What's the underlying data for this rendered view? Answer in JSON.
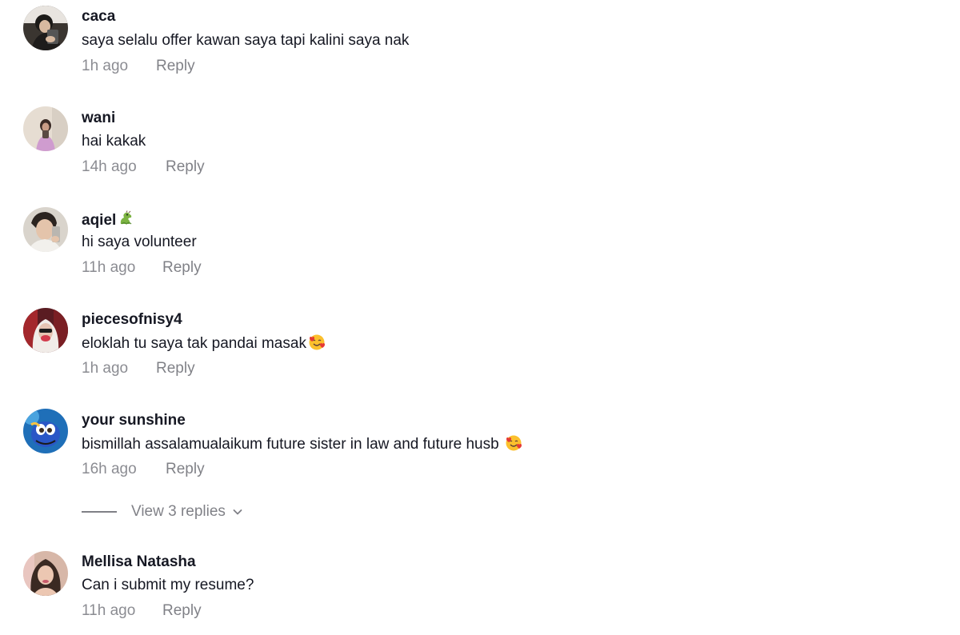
{
  "comments": [
    {
      "username": "caca",
      "text": "saya selalu offer kawan saya tapi kalini saya nak",
      "time": "1h ago",
      "reply_label": "Reply",
      "avatar_icon": "avatar-photo"
    },
    {
      "username": "wani",
      "text": "hai kakak",
      "time": "14h ago",
      "reply_label": "Reply",
      "avatar_icon": "avatar-photo"
    },
    {
      "username": "aqiel",
      "username_emoji": "dragon-emoji",
      "text": "hi saya volunteer",
      "time": "11h ago",
      "reply_label": "Reply",
      "avatar_icon": "avatar-photo"
    },
    {
      "username": "piecesofnisy4",
      "text": "eloklah tu saya tak pandai masak",
      "text_emoji": "smiling-face-with-hearts-emoji",
      "time": "1h ago",
      "reply_label": "Reply",
      "avatar_icon": "avatar-photo"
    },
    {
      "username": "your sunshine",
      "text": "bismillah assalamualaikum future sister in law and future husb",
      "text_emoji": "smiling-face-with-hearts-emoji",
      "time": "16h ago",
      "reply_label": "Reply",
      "avatar_icon": "avatar-photo"
    },
    {
      "username": "Mellisa Natasha",
      "text": "Can i submit my resume?",
      "time": "11h ago",
      "reply_label": "Reply",
      "avatar_icon": "avatar-photo"
    }
  ],
  "view_replies": {
    "label": "View 3 replies",
    "icon": "chevron-down-icon"
  },
  "colors": {
    "text_primary": "#161823",
    "text_secondary": "rgba(22,24,35,0.5)",
    "background": "#ffffff"
  }
}
